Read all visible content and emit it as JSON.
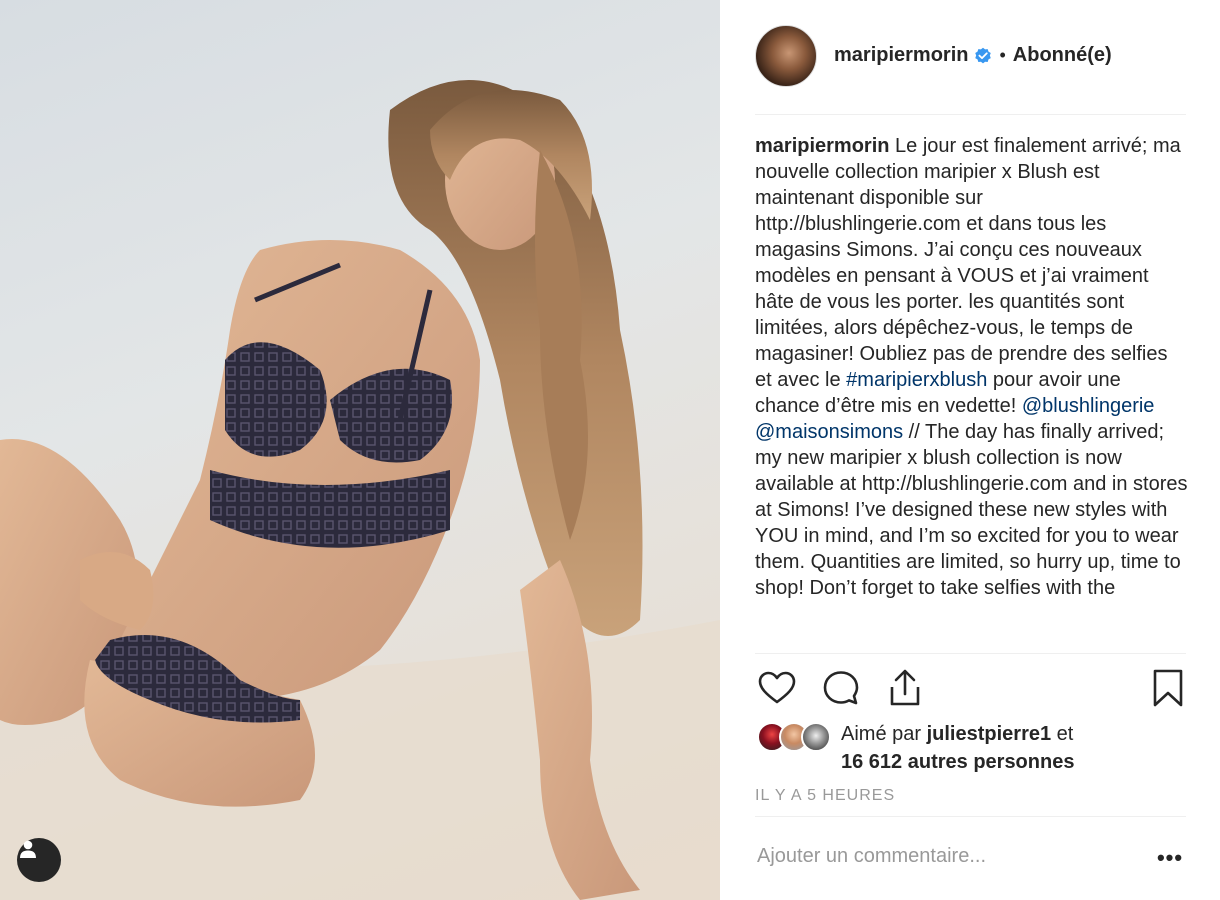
{
  "post": {
    "username": "maripiermorin",
    "follow_status": "Abonné(e)",
    "separator": "•"
  },
  "caption": {
    "username": "maripiermorin",
    "part1": " Le jour est finalement arrivé; ma nouvelle collection maripier x Blush est maintenant disponible sur http://blushlingerie.com et dans tous les magasins Simons. J’ai conçu ces nouveaux modèles en pensant à VOUS et j’ai vraiment hâte de vous les porter. les quantités sont limitées, alors dépêchez-vous, le temps de magasiner! Oubliez pas de prendre des selfies et avec le ",
    "hashtag": "#maripierxblush",
    "part2": " pour avoir une chance d’être mis en vedette! ",
    "mention1": "@blushlingerie",
    "part3": " ",
    "mention2": "@maisonsimons",
    "part4": " // The day has finally arrived; my new maripier x blush collection is now available at http://blushlingerie.com and in stores at Simons! I’ve designed these new styles with YOU in mind, and I’m so excited for you to wear them. Quantities are limited, so hurry up, time to shop! Don’t forget to take selfies with the"
  },
  "likes": {
    "prefix": "Aimé par ",
    "user": "juliestpierre1",
    "middle": " et",
    "count": "16 612 autres personnes"
  },
  "timestamp": "IL Y A 5 HEURES",
  "comment_placeholder": "Ajouter un commentaire...",
  "more_label": "•••",
  "icons": {
    "heart": "heart-icon",
    "comment": "comment-icon",
    "share": "share-icon",
    "save": "bookmark-icon",
    "verified": "verified-badge-icon",
    "tag": "user-tag-icon"
  },
  "colors": {
    "link": "#003569",
    "verified": "#3897f0",
    "muted": "#999999",
    "text": "#262626"
  }
}
